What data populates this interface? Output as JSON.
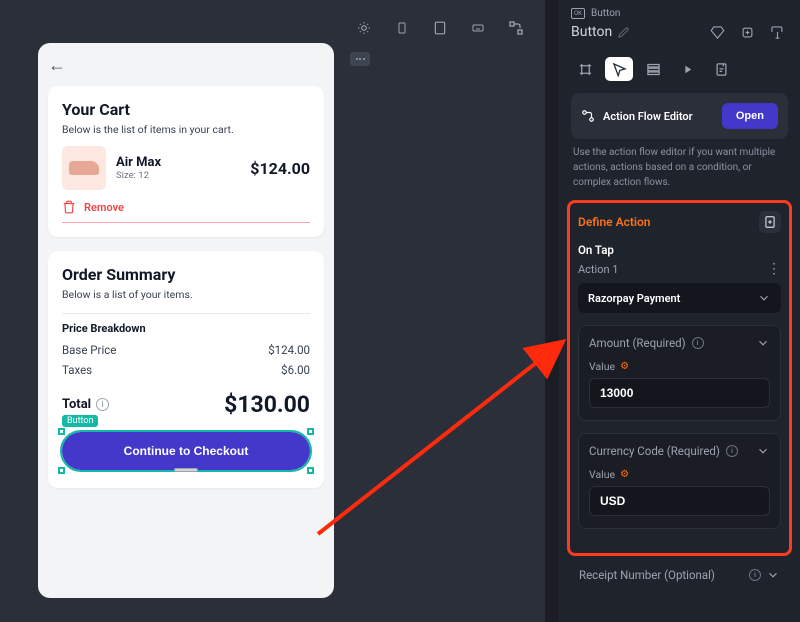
{
  "topbar": {
    "icons": [
      "sun-icon",
      "phone-icon",
      "tablet-icon",
      "keyboard-icon",
      "flow-icon"
    ]
  },
  "cart": {
    "title": "Your Cart",
    "subtitle": "Below is the list of items in your cart.",
    "item": {
      "name": "Air Max",
      "size": "Size: 12",
      "price": "$124.00"
    },
    "remove": "Remove"
  },
  "summary": {
    "title": "Order Summary",
    "subtitle": "Below is a list of your items.",
    "breakdown_label": "Price Breakdown",
    "base_label": "Base Price",
    "base_value": "$124.00",
    "tax_label": "Taxes",
    "tax_value": "$6.00",
    "total_label": "Total",
    "total_value": "$130.00",
    "checkout": "Continue to Checkout",
    "selection_tag": "Button"
  },
  "inspector": {
    "type": "Button",
    "name": "Button",
    "afe_title": "Action Flow Editor",
    "afe_open": "Open",
    "afe_desc": "Use the action flow editor if you want multiple actions, actions based on a condition, or complex action flows.",
    "define": "Define Action",
    "ontap": "On Tap",
    "action_n": "Action 1",
    "action_type": "Razorpay Payment",
    "amount_title": "Amount (Required)",
    "amount_value_label": "Value",
    "amount_value": "13000",
    "currency_title": "Currency Code (Required)",
    "currency_value_label": "Value",
    "currency_value": "USD",
    "receipt_title": "Receipt Number (Optional)"
  }
}
